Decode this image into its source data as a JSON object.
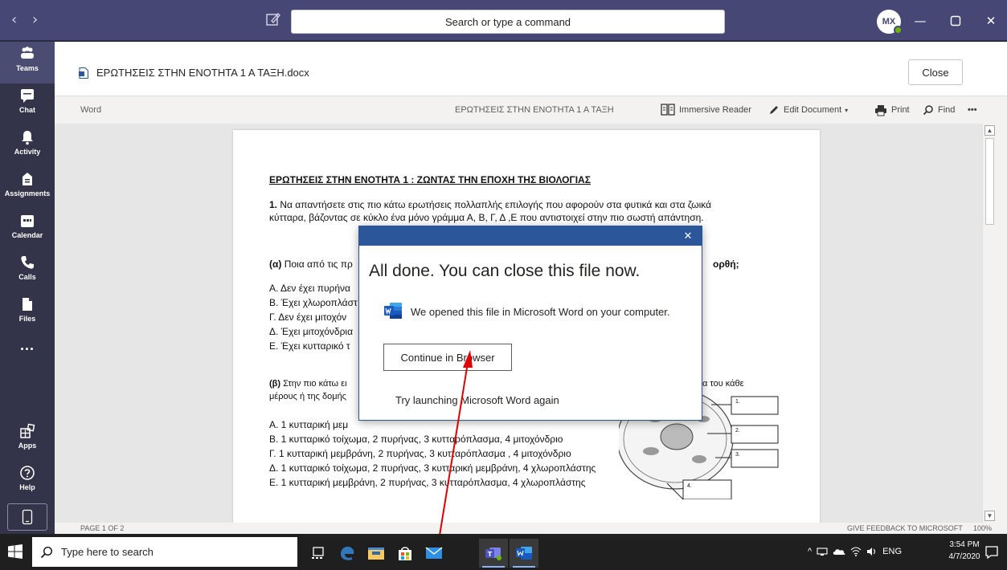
{
  "titlebar": {
    "search_placeholder": "Search or type a command",
    "avatar_initials": "MX"
  },
  "rail": {
    "items": [
      {
        "label": "Teams",
        "icon": "teams-icon"
      },
      {
        "label": "Chat",
        "icon": "chat-icon"
      },
      {
        "label": "Activity",
        "icon": "bell-icon"
      },
      {
        "label": "Assignments",
        "icon": "assignments-icon"
      },
      {
        "label": "Calendar",
        "icon": "calendar-icon"
      },
      {
        "label": "Calls",
        "icon": "phone-icon"
      },
      {
        "label": "Files",
        "icon": "file-icon"
      }
    ],
    "more_label": "...",
    "bottom_items": [
      {
        "label": "Apps",
        "icon": "apps-icon"
      },
      {
        "label": "Help",
        "icon": "help-icon"
      }
    ]
  },
  "document": {
    "file_name": "ΕΡΩΤΗΣΕΙΣ ΣΤΗΝ ΕΝΟΤΗΤΑ 1 Α ΤΑΞΗ.docx",
    "close_label": "Close"
  },
  "wordbar": {
    "app_label": "Word",
    "doc_title": "ΕΡΩΤΗΣΕΙΣ ΣΤΗΝ ΕΝΟΤΗΤΑ 1 Α ΤΑΞΗ",
    "immersive_reader": "Immersive Reader",
    "edit_document": "Edit Document",
    "print": "Print",
    "find": "Find",
    "more": "•••"
  },
  "page_content": {
    "heading_prefix": "ΕΡΩΤΗΣΕΙΣ ΣΤΗΝ ΕΝΟΤΗΤΑ 1",
    "heading_rest": " : ΖΩΝΤΑΣ ΤΗΝ ΕΠΟΧΗ ΤΗΣ ΒΙΟΛΟΓΙΑΣ",
    "q1_number": "1.",
    "q1_line1": " Να απαντήσετε στις πιο κάτω ερωτήσεις πολλαπλής επιλογής που αφορούν στα φυτικά και στα ζωικά",
    "q1_line2": "κύτταρα, βάζοντας σε κύκλο ένα μόνο γράμμα Α, Β, Γ, Δ ,Ε που αντιστοιχεί στην πιο σωστή απάντηση.",
    "qa_label": "(α)",
    "qa_text": " Ποια από τις πρ",
    "qa_end": "ορθή;",
    "qa_options": [
      "Α.  Δεν έχει πυρήνα",
      "Β. Έχει χλωροπλάστ",
      "Γ.  Δεν έχει μιτοχόν",
      "Δ. Έχει μιτοχόνδρια",
      "Ε. Έχει κυτταρικό τ"
    ],
    "qb_label": "(β)",
    "qb_text": " Στην πιο κάτω ει",
    "qb_end": "α του κάθε",
    "qb_line2": "μέρους ή της δομής",
    "qb_options": [
      "Α.  1 κυτταρική μεμ",
      "Β.  1 κυτταρικό τοίχωμα,  2 πυρήνας,  3 κυτταρόπλασμα, 4 μιτοχόνδριο",
      "Γ.  1 κυτταρική μεμβράνη,  2 πυρήνας,  3 κυτταρόπλασμα , 4 μιτοχόνδριο",
      "Δ.  1 κυτταρικό τοίχωμα,   2 πυρήνας,  3 κυτταρική μεμβράνη,  4 χλωροπλάστης",
      "Ε.  1 κυτταρική μεμβράνη, 2 πυρήνας,  3 κυτταρόπλασμα, 4 χλωροπλάστης"
    ],
    "diagram_labels": [
      "1.",
      "2.",
      "3.",
      "4."
    ]
  },
  "statusbar": {
    "page": "PAGE 1 OF 2",
    "feedback": "GIVE FEEDBACK TO MICROSOFT",
    "zoom": "100%"
  },
  "dialog": {
    "heading": "All done. You can close this file now.",
    "message": "We opened this file in Microsoft Word on your computer.",
    "continue_label": "Continue in Browser",
    "retry_label": "Try launching Microsoft Word again"
  },
  "taskbar": {
    "search_placeholder": "Type here to search",
    "language": "ENG",
    "time": "3:54 PM",
    "date": "4/7/2020"
  },
  "colors": {
    "teams_purple": "#464775",
    "rail": "#33344a",
    "word_blue": "#2b579a",
    "annotation_red": "#e00000"
  }
}
